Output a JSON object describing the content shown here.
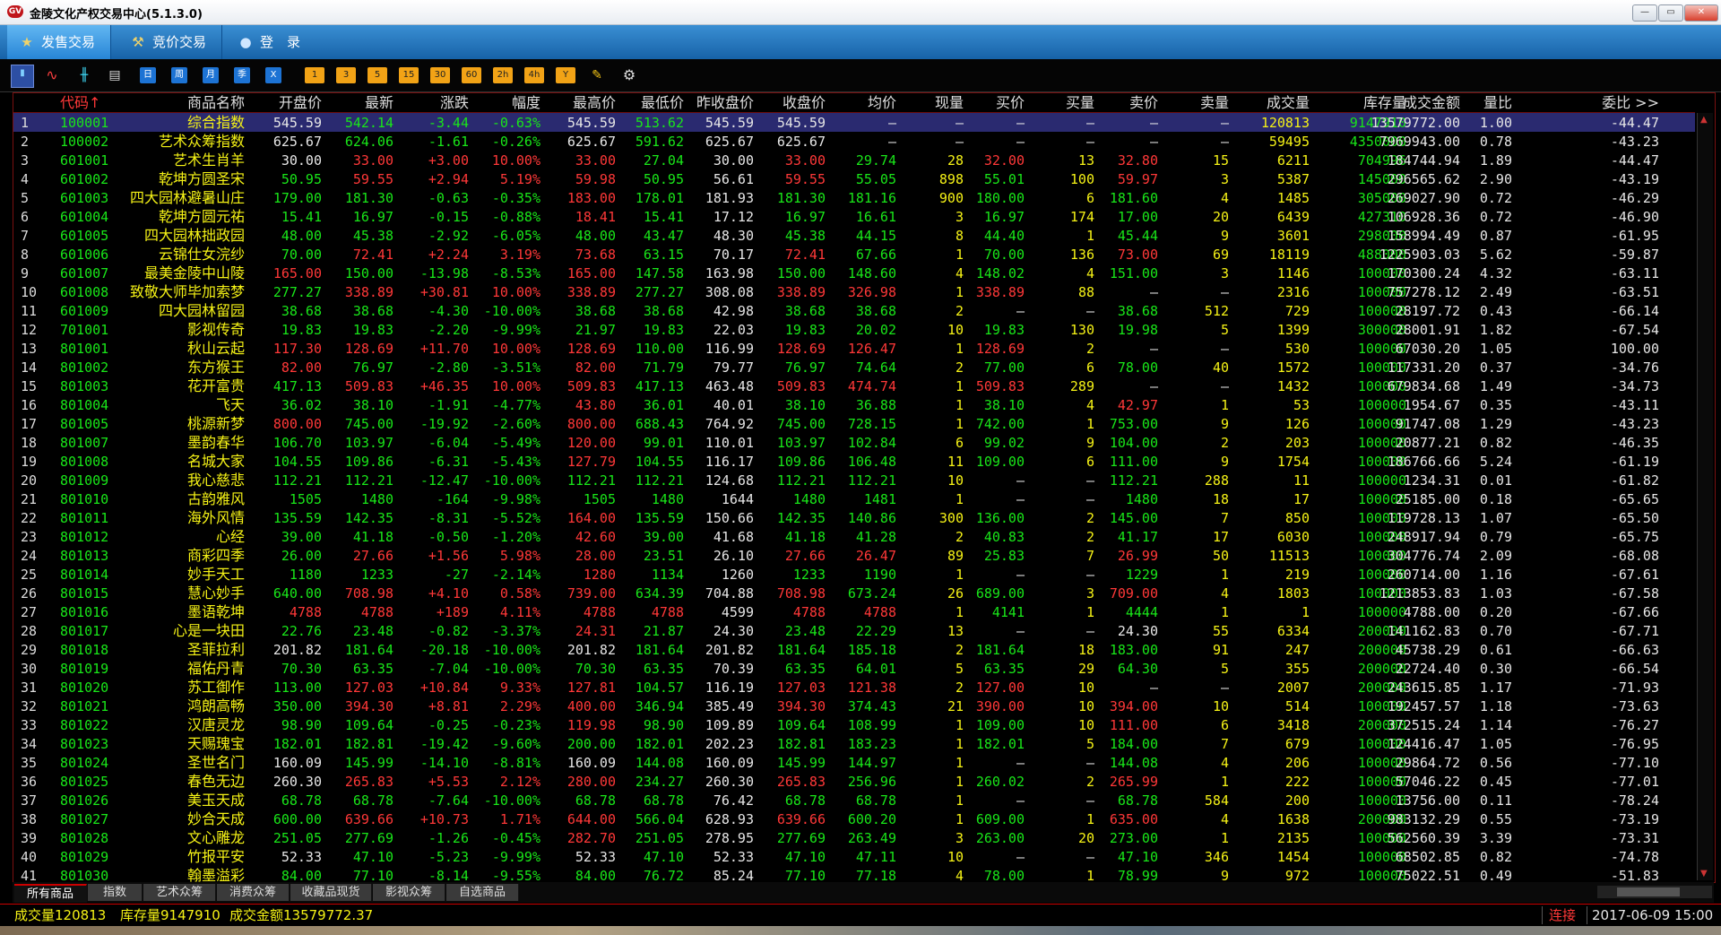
{
  "window": {
    "title": "金陵文化产权交易中心(5.1.3.0)",
    "logo_text": "GV",
    "btn_min": "—",
    "btn_max": "▭",
    "btn_close": "✕"
  },
  "tabs": [
    {
      "label": "发售交易",
      "icon": "★",
      "active": true
    },
    {
      "label": "竞价交易",
      "icon": "⚒",
      "active": false
    },
    {
      "label": "登　录",
      "icon": "●",
      "active": false
    }
  ],
  "toolbar": {
    "chart_icons": [
      "▮",
      "∿",
      "╫",
      "▤"
    ],
    "period_buttons": [
      "日",
      "周",
      "月",
      "季",
      "X"
    ],
    "minute_buttons": [
      "1",
      "3",
      "5",
      "15",
      "30",
      "60",
      "2h",
      "4h",
      "Y"
    ],
    "tool_icons": [
      "✎",
      "⚙"
    ]
  },
  "columns": [
    "代码↑",
    "商品名称",
    "开盘价",
    "最新",
    "涨跌",
    "幅度",
    "最高价",
    "最低价",
    "昨收盘价",
    "收盘价",
    "均价",
    "现量",
    "买价",
    "买量",
    "卖价",
    "卖量",
    "成交量",
    "库存量",
    "成交金额",
    "量比",
    "委比 >>"
  ],
  "rows": [
    [
      "1",
      "100001",
      "综合指数",
      "545.59",
      "542.14",
      "-3.44",
      "-0.63%",
      "545.59",
      "513.62",
      "545.59",
      "545.59",
      "—",
      "—",
      "—",
      "—",
      "—",
      "—",
      "120813",
      "9147910",
      "13579772.00",
      "1.00",
      "-44.47"
    ],
    [
      "2",
      "100002",
      "艺术众筹指数",
      "625.67",
      "624.06",
      "-1.61",
      "-0.26%",
      "625.67",
      "591.62",
      "625.67",
      "625.67",
      "—",
      "—",
      "—",
      "—",
      "—",
      "—",
      "59495",
      "4350000",
      "7969943.00",
      "0.78",
      "-43.23"
    ],
    [
      "3",
      "601001",
      "艺术生肖羊",
      "30.00",
      "33.00",
      "+3.00",
      "10.00%",
      "33.00",
      "27.04",
      "30.00",
      "33.00",
      "29.74",
      "28",
      "32.00",
      "13",
      "32.80",
      "15",
      "6211",
      "704996",
      "184744.94",
      "1.89",
      "-44.47"
    ],
    [
      "4",
      "601002",
      "乾坤方圆圣宋",
      "50.95",
      "59.55",
      "+2.94",
      "5.19%",
      "59.98",
      "50.95",
      "56.61",
      "59.55",
      "55.05",
      "898",
      "55.01",
      "100",
      "59.97",
      "3",
      "5387",
      "145000",
      "296565.62",
      "2.90",
      "-43.19"
    ],
    [
      "5",
      "601003",
      "四大园林避暑山庄",
      "179.00",
      "181.30",
      "-0.63",
      "-0.35%",
      "183.00",
      "178.01",
      "181.93",
      "181.30",
      "181.16",
      "900",
      "180.00",
      "6",
      "181.60",
      "4",
      "1485",
      "305000",
      "269027.90",
      "0.72",
      "-46.29"
    ],
    [
      "6",
      "601004",
      "乾坤方圆元祐",
      "15.41",
      "16.97",
      "-0.15",
      "-0.88%",
      "18.41",
      "15.41",
      "17.12",
      "16.97",
      "16.61",
      "3",
      "16.97",
      "174",
      "17.00",
      "20",
      "6439",
      "427310",
      "106928.36",
      "0.72",
      "-46.90"
    ],
    [
      "7",
      "601005",
      "四大园林拙政园",
      "48.00",
      "45.38",
      "-2.92",
      "-6.05%",
      "48.00",
      "43.47",
      "48.30",
      "45.38",
      "44.15",
      "8",
      "44.40",
      "1",
      "45.44",
      "9",
      "3601",
      "298000",
      "158994.49",
      "0.87",
      "-61.95"
    ],
    [
      "8",
      "601006",
      "云锦仕女浣纱",
      "70.00",
      "72.41",
      "+2.24",
      "3.19%",
      "73.68",
      "63.15",
      "70.17",
      "72.41",
      "67.66",
      "1",
      "70.00",
      "136",
      "73.00",
      "69",
      "18119",
      "488000",
      "1225903.03",
      "5.62",
      "-59.87"
    ],
    [
      "9",
      "601007",
      "最美金陵中山陵",
      "165.00",
      "150.00",
      "-13.98",
      "-8.53%",
      "165.00",
      "147.58",
      "163.98",
      "150.00",
      "148.60",
      "4",
      "148.02",
      "4",
      "151.00",
      "3",
      "1146",
      "100000",
      "170300.24",
      "4.32",
      "-63.11"
    ],
    [
      "10",
      "601008",
      "致敬大师毕加索梦",
      "277.27",
      "338.89",
      "+30.81",
      "10.00%",
      "338.89",
      "277.27",
      "308.08",
      "338.89",
      "326.98",
      "1",
      "338.89",
      "88",
      "—",
      "—",
      "2316",
      "100000",
      "757278.12",
      "2.49",
      "-63.51"
    ],
    [
      "11",
      "601009",
      "四大园林留园",
      "38.68",
      "38.68",
      "-4.30",
      "-10.00%",
      "38.68",
      "38.68",
      "42.98",
      "38.68",
      "38.68",
      "2",
      "—",
      "—",
      "38.68",
      "512",
      "729",
      "100000",
      "28197.72",
      "0.43",
      "-66.14"
    ],
    [
      "12",
      "701001",
      "影视传奇",
      "19.83",
      "19.83",
      "-2.20",
      "-9.99%",
      "21.97",
      "19.83",
      "22.03",
      "19.83",
      "20.02",
      "10",
      "19.83",
      "130",
      "19.98",
      "5",
      "1399",
      "300000",
      "28001.91",
      "1.82",
      "-67.54"
    ],
    [
      "13",
      "801001",
      "秋山云起",
      "117.30",
      "128.69",
      "+11.70",
      "10.00%",
      "128.69",
      "110.00",
      "116.99",
      "128.69",
      "126.47",
      "1",
      "128.69",
      "2",
      "—",
      "—",
      "530",
      "100000",
      "67030.20",
      "1.05",
      "100.00"
    ],
    [
      "14",
      "801002",
      "东方猴王",
      "82.00",
      "76.97",
      "-2.80",
      "-3.51%",
      "82.00",
      "71.79",
      "79.77",
      "76.97",
      "74.64",
      "2",
      "77.00",
      "6",
      "78.00",
      "40",
      "1572",
      "100000",
      "117331.20",
      "0.37",
      "-34.76"
    ],
    [
      "15",
      "801003",
      "花开富贵",
      "417.13",
      "509.83",
      "+46.35",
      "10.00%",
      "509.83",
      "417.13",
      "463.48",
      "509.83",
      "474.74",
      "1",
      "509.83",
      "289",
      "—",
      "—",
      "1432",
      "100000",
      "679834.68",
      "1.49",
      "-34.73"
    ],
    [
      "16",
      "801004",
      "飞天",
      "36.02",
      "38.10",
      "-1.91",
      "-4.77%",
      "43.80",
      "36.01",
      "40.01",
      "38.10",
      "36.88",
      "1",
      "38.10",
      "4",
      "42.97",
      "1",
      "53",
      "100000",
      "1954.67",
      "0.35",
      "-43.11"
    ],
    [
      "17",
      "801005",
      "桃源新梦",
      "800.00",
      "745.00",
      "-19.92",
      "-2.60%",
      "800.00",
      "688.43",
      "764.92",
      "745.00",
      "728.15",
      "1",
      "742.00",
      "1",
      "753.00",
      "9",
      "126",
      "100000",
      "91747.08",
      "1.29",
      "-43.23"
    ],
    [
      "18",
      "801007",
      "墨韵春华",
      "106.70",
      "103.97",
      "-6.04",
      "-5.49%",
      "120.00",
      "99.01",
      "110.01",
      "103.97",
      "102.84",
      "6",
      "99.02",
      "9",
      "104.00",
      "2",
      "203",
      "100000",
      "20877.21",
      "0.82",
      "-46.35"
    ],
    [
      "19",
      "801008",
      "名城大家",
      "104.55",
      "109.86",
      "-6.31",
      "-5.43%",
      "127.79",
      "104.55",
      "116.17",
      "109.86",
      "106.48",
      "11",
      "109.00",
      "6",
      "111.00",
      "9",
      "1754",
      "100000",
      "186766.66",
      "5.24",
      "-61.19"
    ],
    [
      "20",
      "801009",
      "我心慈悲",
      "112.21",
      "112.21",
      "-12.47",
      "-10.00%",
      "112.21",
      "112.21",
      "124.68",
      "112.21",
      "112.21",
      "10",
      "—",
      "—",
      "112.21",
      "288",
      "11",
      "100000",
      "1234.31",
      "0.01",
      "-61.82"
    ],
    [
      "21",
      "801010",
      "古韵雅风",
      "1505",
      "1480",
      "-164",
      "-9.98%",
      "1505",
      "1480",
      "1644",
      "1480",
      "1481",
      "1",
      "—",
      "—",
      "1480",
      "18",
      "17",
      "100000",
      "25185.00",
      "0.18",
      "-65.65"
    ],
    [
      "22",
      "801011",
      "海外风情",
      "135.59",
      "142.35",
      "-8.31",
      "-5.52%",
      "164.00",
      "135.59",
      "150.66",
      "142.35",
      "140.86",
      "300",
      "136.00",
      "2",
      "145.00",
      "7",
      "850",
      "100000",
      "119728.13",
      "1.07",
      "-65.50"
    ],
    [
      "23",
      "801012",
      "心经",
      "39.00",
      "41.18",
      "-0.50",
      "-1.20%",
      "42.60",
      "39.00",
      "41.68",
      "41.18",
      "41.28",
      "2",
      "40.83",
      "2",
      "41.17",
      "17",
      "6030",
      "100000",
      "248917.94",
      "0.79",
      "-65.75"
    ],
    [
      "24",
      "801013",
      "商彩四季",
      "26.00",
      "27.66",
      "+1.56",
      "5.98%",
      "28.00",
      "23.51",
      "26.10",
      "27.66",
      "26.47",
      "89",
      "25.83",
      "7",
      "26.99",
      "50",
      "11513",
      "100000",
      "304776.74",
      "2.09",
      "-68.08"
    ],
    [
      "25",
      "801014",
      "妙手天工",
      "1180",
      "1233",
      "-27",
      "-2.14%",
      "1280",
      "1134",
      "1260",
      "1233",
      "1190",
      "1",
      "—",
      "—",
      "1229",
      "1",
      "219",
      "100000",
      "260714.00",
      "1.16",
      "-67.61"
    ],
    [
      "26",
      "801015",
      "慧心妙手",
      "640.00",
      "708.98",
      "+4.10",
      "0.58%",
      "739.00",
      "634.39",
      "704.88",
      "708.98",
      "673.24",
      "26",
      "689.00",
      "3",
      "709.00",
      "4",
      "1803",
      "100000",
      "1213853.83",
      "1.03",
      "-67.58"
    ],
    [
      "27",
      "801016",
      "墨语乾坤",
      "4788",
      "4788",
      "+189",
      "4.11%",
      "4788",
      "4788",
      "4599",
      "4788",
      "4788",
      "1",
      "4141",
      "1",
      "4444",
      "1",
      "1",
      "100000",
      "4788.00",
      "0.20",
      "-67.66"
    ],
    [
      "28",
      "801017",
      "心是一块田",
      "22.76",
      "23.48",
      "-0.82",
      "-3.37%",
      "24.31",
      "21.87",
      "24.30",
      "23.48",
      "22.29",
      "13",
      "—",
      "—",
      "24.30",
      "55",
      "6334",
      "200000",
      "141162.83",
      "0.70",
      "-67.71"
    ],
    [
      "29",
      "801018",
      "圣菲拉利",
      "201.82",
      "181.64",
      "-20.18",
      "-10.00%",
      "201.82",
      "181.64",
      "201.82",
      "181.64",
      "185.18",
      "2",
      "181.64",
      "18",
      "183.00",
      "91",
      "247",
      "200000",
      "45738.29",
      "0.61",
      "-66.63"
    ],
    [
      "30",
      "801019",
      "福佑丹青",
      "70.30",
      "63.35",
      "-7.04",
      "-10.00%",
      "70.30",
      "63.35",
      "70.39",
      "63.35",
      "64.01",
      "5",
      "63.35",
      "29",
      "64.30",
      "5",
      "355",
      "200000",
      "22724.40",
      "0.30",
      "-66.54"
    ],
    [
      "31",
      "801020",
      "苏工御作",
      "113.00",
      "127.03",
      "+10.84",
      "9.33%",
      "127.81",
      "104.57",
      "116.19",
      "127.03",
      "121.38",
      "2",
      "127.00",
      "10",
      "—",
      "—",
      "2007",
      "200000",
      "243615.85",
      "1.17",
      "-71.93"
    ],
    [
      "32",
      "801021",
      "鸿朗高畅",
      "350.00",
      "394.30",
      "+8.81",
      "2.29%",
      "400.00",
      "346.94",
      "385.49",
      "394.30",
      "374.43",
      "21",
      "390.00",
      "10",
      "394.00",
      "10",
      "514",
      "100000",
      "192457.57",
      "1.18",
      "-73.63"
    ],
    [
      "33",
      "801022",
      "汉唐灵龙",
      "98.90",
      "109.64",
      "-0.25",
      "-0.23%",
      "119.98",
      "98.90",
      "109.89",
      "109.64",
      "108.99",
      "1",
      "109.00",
      "10",
      "111.00",
      "6",
      "3418",
      "200000",
      "372515.24",
      "1.14",
      "-76.27"
    ],
    [
      "34",
      "801023",
      "天赐瑰宝",
      "182.01",
      "182.81",
      "-19.42",
      "-9.60%",
      "200.00",
      "182.01",
      "202.23",
      "182.81",
      "183.23",
      "1",
      "182.01",
      "5",
      "184.00",
      "7",
      "679",
      "100000",
      "124416.47",
      "1.05",
      "-76.95"
    ],
    [
      "35",
      "801024",
      "圣世名门",
      "160.09",
      "145.99",
      "-14.10",
      "-8.81%",
      "160.09",
      "144.08",
      "160.09",
      "145.99",
      "144.97",
      "1",
      "—",
      "—",
      "144.08",
      "4",
      "206",
      "100000",
      "29864.72",
      "0.56",
      "-77.10"
    ],
    [
      "36",
      "801025",
      "春色无边",
      "260.30",
      "265.83",
      "+5.53",
      "2.12%",
      "280.00",
      "234.27",
      "260.30",
      "265.83",
      "256.96",
      "1",
      "260.02",
      "2",
      "265.99",
      "1",
      "222",
      "100000",
      "57046.22",
      "0.45",
      "-77.01"
    ],
    [
      "37",
      "801026",
      "美玉天成",
      "68.78",
      "68.78",
      "-7.64",
      "-10.00%",
      "68.78",
      "68.78",
      "76.42",
      "68.78",
      "68.78",
      "1",
      "—",
      "—",
      "68.78",
      "584",
      "200",
      "100000",
      "13756.00",
      "0.11",
      "-78.24"
    ],
    [
      "38",
      "801027",
      "妙合天成",
      "600.00",
      "639.66",
      "+10.73",
      "1.71%",
      "644.00",
      "566.04",
      "628.93",
      "639.66",
      "600.20",
      "1",
      "609.00",
      "1",
      "635.00",
      "4",
      "1638",
      "200000",
      "983132.29",
      "0.55",
      "-73.19"
    ],
    [
      "39",
      "801028",
      "文心雕龙",
      "251.05",
      "277.69",
      "-1.26",
      "-0.45%",
      "282.70",
      "251.05",
      "278.95",
      "277.69",
      "263.49",
      "3",
      "263.00",
      "20",
      "273.00",
      "1",
      "2135",
      "100000",
      "562560.39",
      "3.39",
      "-73.31"
    ],
    [
      "40",
      "801029",
      "竹报平安",
      "52.33",
      "47.10",
      "-5.23",
      "-9.99%",
      "52.33",
      "47.10",
      "52.33",
      "47.10",
      "47.11",
      "10",
      "—",
      "—",
      "47.10",
      "346",
      "1454",
      "100000",
      "68502.85",
      "0.82",
      "-74.78"
    ],
    [
      "41",
      "801030",
      "翰墨溢彩",
      "84.00",
      "77.10",
      "-8.14",
      "-9.55%",
      "84.00",
      "76.72",
      "85.24",
      "77.10",
      "77.18",
      "4",
      "78.00",
      "1",
      "78.99",
      "9",
      "972",
      "100000",
      "75022.51",
      "0.49",
      "-51.83"
    ]
  ],
  "bottom_tabs": [
    "所有商品",
    "指数",
    "艺术众筹",
    "消费众筹",
    "收藏品现货",
    "影视众筹",
    "自选商品"
  ],
  "status": {
    "volume": "成交量120813",
    "stock": "库存量9147910",
    "amount": "成交金额13579772.37",
    "connection": "连接",
    "datetime": "2017-06-09 15:00"
  },
  "colors": {
    "up": "#ff3838",
    "down": "#19e619",
    "flat": "#e6e6e6",
    "code": "#19e619",
    "name": "#f5f216",
    "index": "#ffffff",
    "volume_col": "#f5f216",
    "stock_col": "#19e619"
  }
}
